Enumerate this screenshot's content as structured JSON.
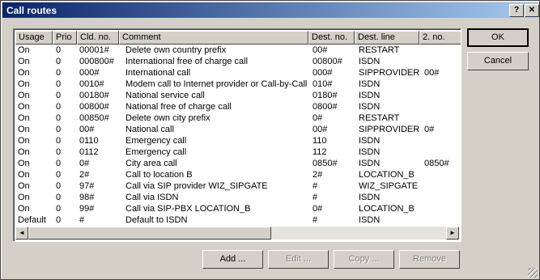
{
  "window": {
    "title": "Call routes",
    "help_label": "?",
    "close_label": "✕"
  },
  "columns": [
    "Usage",
    "Prio",
    "Cld. no.",
    "Comment",
    "Dest. no.",
    "Dest. line",
    "2. no."
  ],
  "rows": [
    [
      "On",
      "0",
      "00001#",
      "Delete own country prefix",
      "00#",
      "RESTART",
      ""
    ],
    [
      "On",
      "0",
      "000800#",
      "International free of charge call",
      "00800#",
      "ISDN",
      ""
    ],
    [
      "On",
      "0",
      "000#",
      "International call",
      "000#",
      "SIPPROVIDER",
      "00#"
    ],
    [
      "On",
      "0",
      "0010#",
      "Modem call to Internet provider or Call-by-Call",
      "010#",
      "ISDN",
      ""
    ],
    [
      "On",
      "0",
      "00180#",
      "National service call",
      "0180#",
      "ISDN",
      ""
    ],
    [
      "On",
      "0",
      "00800#",
      "National free of charge call",
      "0800#",
      "ISDN",
      ""
    ],
    [
      "On",
      "0",
      "00850#",
      "Delete own city prefix",
      "0#",
      "RESTART",
      ""
    ],
    [
      "On",
      "0",
      "00#",
      "National call",
      "00#",
      "SIPPROVIDER",
      "0#"
    ],
    [
      "On",
      "0",
      "0110",
      "Emergency call",
      "110",
      "ISDN",
      ""
    ],
    [
      "On",
      "0",
      "0112",
      "Emergency call",
      "112",
      "ISDN",
      ""
    ],
    [
      "On",
      "0",
      "0#",
      "City area call",
      "0850#",
      "ISDN",
      "0850#"
    ],
    [
      "On",
      "0",
      "2#",
      "Call to location B",
      "2#",
      "LOCATION_B",
      ""
    ],
    [
      "On",
      "0",
      "97#",
      "Call via SIP provider WIZ_SIPGATE",
      "#",
      "WIZ_SIPGATE",
      ""
    ],
    [
      "On",
      "0",
      "98#",
      "Call via ISDN",
      "#",
      "ISDN",
      ""
    ],
    [
      "On",
      "0",
      "99#",
      "Call via SIP-PBX LOCATION_B",
      "0#",
      "LOCATION_B",
      ""
    ],
    [
      "Default",
      "0",
      "#",
      "Default to ISDN",
      "#",
      "ISDN",
      ""
    ]
  ],
  "buttons": {
    "ok": "OK",
    "cancel": "Cancel",
    "add": "Add ...",
    "edit": "Edit ...",
    "copy": "Copy ...",
    "remove": "Remove"
  },
  "scroll": {
    "left_icon": "◄",
    "right_icon": "►"
  }
}
